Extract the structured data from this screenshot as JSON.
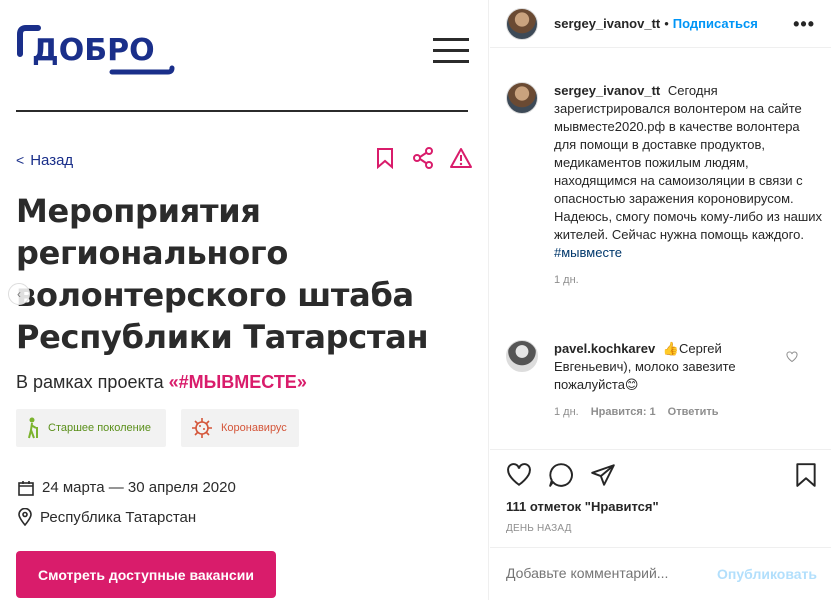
{
  "post_image": {
    "logo_text": "ДОБРО",
    "back_label": "Назад",
    "title_lines": [
      "Мероприятия",
      "регионального",
      "волонтерского штаба",
      "Республики Татарстан"
    ],
    "subtitle_prefix": "В рамках проекта",
    "project": "«#МЫВМЕСТЕ»",
    "tags": [
      {
        "label": "Старшее поколение",
        "icon": "elderly-person-icon"
      },
      {
        "label": "Коронавирус",
        "icon": "virus-icon"
      }
    ],
    "dates": "24 марта — 30 апреля 2020",
    "location": "Республика Татарстан",
    "cta": "Смотреть доступные вакансии",
    "colors": {
      "brand_blue": "#1a2f8a",
      "brand_pink": "#d91c6b"
    }
  },
  "instagram": {
    "header": {
      "username": "sergey_ivanov_tt",
      "dot": "•",
      "follow": "Подписаться"
    },
    "caption": {
      "username": "sergey_ivanov_tt",
      "text": "Сегодня зарегистрировался волонтером на сайте мывместе2020.рф в качестве волонтера для помощи в доставке продуктов, медикаментов пожилым людям, находящимся на самоизоляции в связи с опасностью заражения короновирусом. Надеюсь, смогу помочь кому-либо из наших жителей. Сейчас нужна помощь каждого.",
      "hashtag": "#мывместе",
      "time": "1 дн."
    },
    "comment": {
      "username": "pavel.kochkarev",
      "text": "👍Сергей Евгеньевич), молоко завезите пожалуйста😊",
      "time": "1 дн.",
      "likes": "Нравится: 1",
      "reply": "Ответить"
    },
    "likes": "111 отметок \"Нравится\"",
    "date": "ДЕНЬ НАЗАД",
    "add_comment_placeholder": "Добавьте комментарий...",
    "publish": "Опубликовать",
    "colors": {
      "link": "#0095f6",
      "hashtag": "#00376b"
    }
  }
}
